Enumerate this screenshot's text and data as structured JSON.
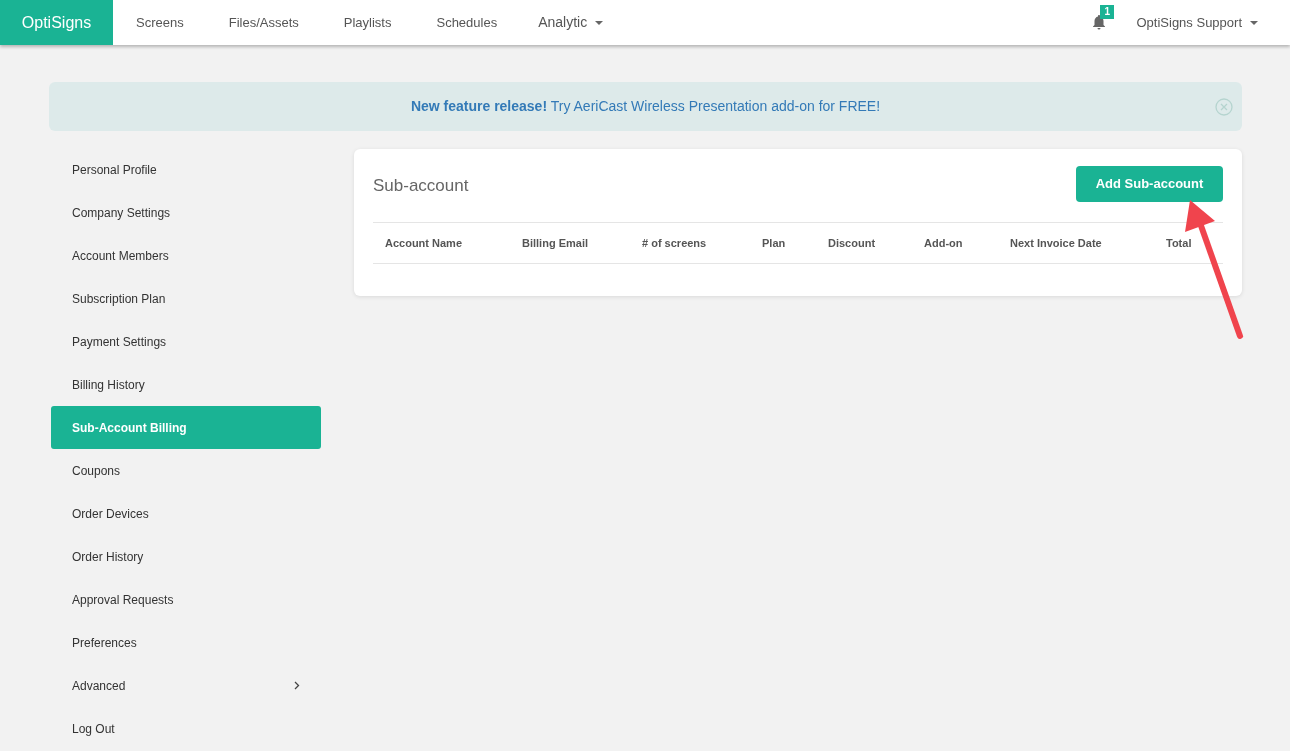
{
  "navbar": {
    "brand": "OptiSigns",
    "items": [
      {
        "label": "Screens",
        "kind": "link"
      },
      {
        "label": "Files/Assets",
        "kind": "link"
      },
      {
        "label": "Playlists",
        "kind": "link"
      },
      {
        "label": "Schedules",
        "kind": "link"
      },
      {
        "label": "Analytic",
        "kind": "dropdown"
      }
    ],
    "notification_count": "1",
    "user": "OptiSigns Support"
  },
  "banner": {
    "text": "**New feature release!** Try AeriCast Wireless Presentation add-on for FREE!"
  },
  "sidebar": {
    "items": [
      {
        "label": "Personal Profile",
        "selected": false,
        "kind": "link"
      },
      {
        "label": "Company Settings",
        "selected": false,
        "kind": "link"
      },
      {
        "label": "Account Members",
        "selected": false,
        "kind": "link"
      },
      {
        "label": "Subscription Plan",
        "selected": false,
        "kind": "link"
      },
      {
        "label": "Payment Settings",
        "selected": false,
        "kind": "link"
      },
      {
        "label": "Billing History",
        "selected": false,
        "kind": "link"
      },
      {
        "label": "Sub-Account Billing",
        "selected": true,
        "kind": "link"
      },
      {
        "label": "Coupons",
        "selected": false,
        "kind": "link"
      },
      {
        "label": "Order Devices",
        "selected": false,
        "kind": "link"
      },
      {
        "label": "Order History",
        "selected": false,
        "kind": "link"
      },
      {
        "label": "Approval Requests",
        "selected": false,
        "kind": "link"
      },
      {
        "label": "Preferences",
        "selected": false,
        "kind": "link"
      },
      {
        "label": "Advanced",
        "selected": false,
        "kind": "submenu"
      },
      {
        "label": "Log Out",
        "selected": false,
        "kind": "link"
      }
    ]
  },
  "card": {
    "title": "Sub-account",
    "button": "Add Sub-account",
    "table": {
      "columns": [
        "Account Name",
        "Billing Email",
        "# of screens",
        "Plan",
        "Discount",
        "Add-on",
        "Next Invoice Date",
        "Total"
      ]
    }
  }
}
